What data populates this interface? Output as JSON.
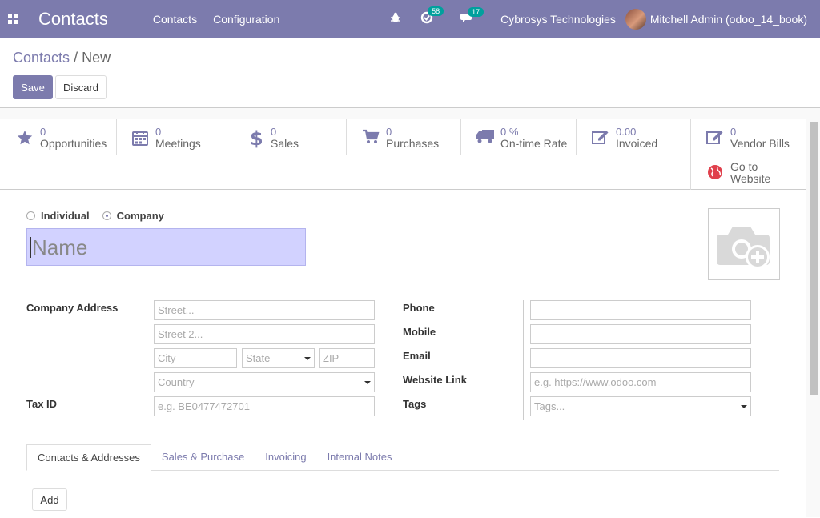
{
  "navbar": {
    "app_title": "Contacts",
    "menu": [
      "Contacts",
      "Configuration"
    ],
    "activity_count": "58",
    "message_count": "17",
    "company": "Cybrosys Technologies",
    "user": "Mitchell Admin (odoo_14_book)",
    "brand_color": "#7c7bad"
  },
  "breadcrumb": {
    "parent": "Contacts",
    "separator": "/",
    "current": "New"
  },
  "toolbar": {
    "save_label": "Save",
    "discard_label": "Discard"
  },
  "smart_buttons": [
    {
      "icon": "star-icon",
      "value": "0",
      "label": "Opportunities"
    },
    {
      "icon": "calendar-icon",
      "value": "0",
      "label": "Meetings"
    },
    {
      "icon": "dollar-icon",
      "value": "0",
      "label": "Sales"
    },
    {
      "icon": "cart-icon",
      "value": "0",
      "label": "Purchases"
    },
    {
      "icon": "truck-icon",
      "value": "0 %",
      "label": "On-time Rate"
    },
    {
      "icon": "edit-icon",
      "value": "0.00",
      "label": "Invoiced"
    },
    {
      "icon": "edit-icon",
      "value": "0",
      "label": "Vendor Bills"
    },
    {
      "icon": "globe-icon",
      "value": "Go to",
      "label": "Website"
    }
  ],
  "form": {
    "type_individual": "Individual",
    "type_company": "Company",
    "name_placeholder": "Name",
    "company_address_label": "Company Address",
    "street_placeholder": "Street...",
    "street2_placeholder": "Street 2...",
    "city_placeholder": "City",
    "state_placeholder": "State",
    "zip_placeholder": "ZIP",
    "country_placeholder": "Country",
    "tax_id_label": "Tax ID",
    "tax_id_placeholder": "e.g. BE0477472701",
    "phone_label": "Phone",
    "mobile_label": "Mobile",
    "email_label": "Email",
    "website_label": "Website Link",
    "website_placeholder": "e.g. https://www.odoo.com",
    "tags_label": "Tags",
    "tags_placeholder": "Tags..."
  },
  "tabs": [
    "Contacts & Addresses",
    "Sales & Purchase",
    "Invoicing",
    "Internal Notes"
  ],
  "add_label": "Add"
}
